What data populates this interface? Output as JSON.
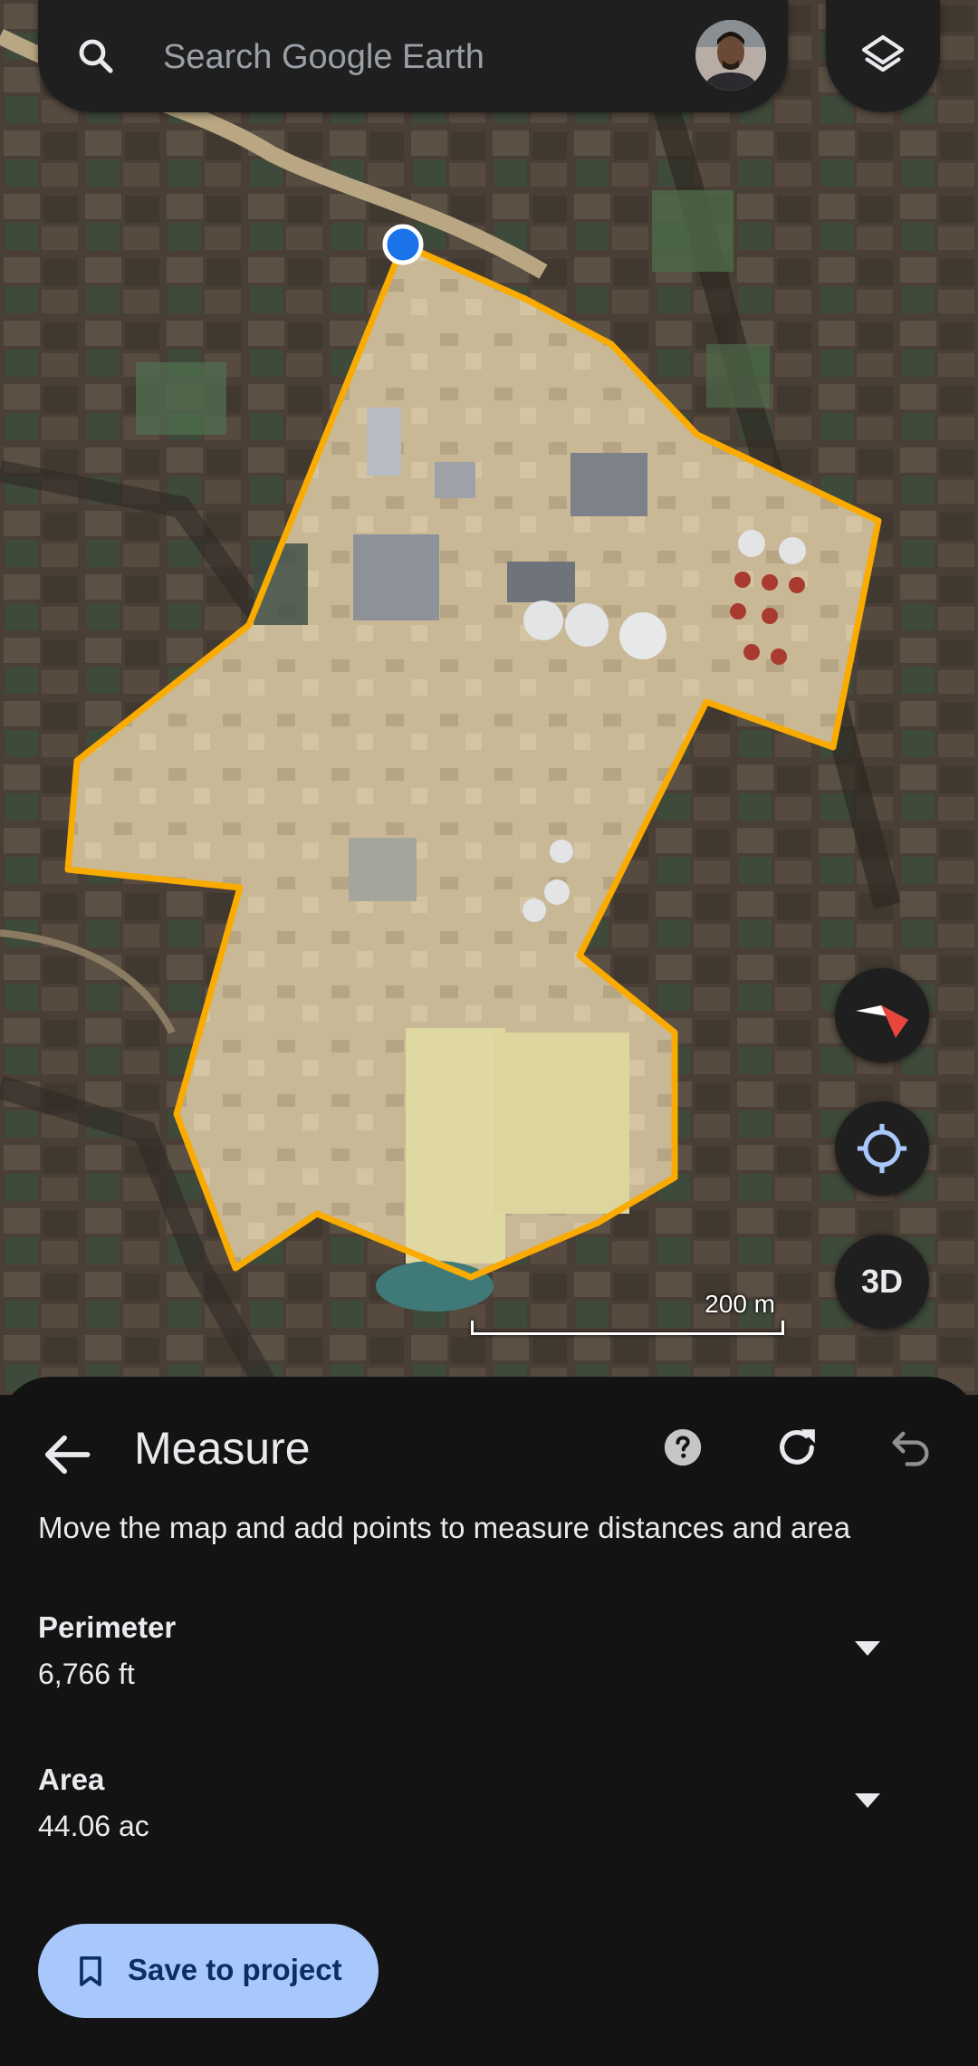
{
  "search": {
    "placeholder": "Search Google Earth",
    "search_icon": "search-icon",
    "avatar_icon": "profile-avatar",
    "layers_icon": "layers-icon"
  },
  "map": {
    "scale_label": "200 m",
    "controls": {
      "compass_icon": "compass-icon",
      "locate_icon": "my-location-icon",
      "view_3d_label": "3D"
    },
    "colors": {
      "polygon_outline": "#f9ab00",
      "point_marker": "#1a73e8"
    }
  },
  "measure": {
    "title": "Measure",
    "instructions": "Move the map and add points to measure distances and area",
    "perimeter_label": "Perimeter",
    "perimeter_value": "6,766 ft",
    "area_label": "Area",
    "area_value": "44.06 ac",
    "save_label": "Save to project",
    "icons": {
      "back": "arrow-back-icon",
      "help": "help-icon",
      "refresh": "refresh-icon",
      "undo": "undo-icon",
      "dropdown": "chevron-down-icon",
      "bookmark": "bookmark-icon"
    },
    "accent_color": "#a8c7fa"
  }
}
